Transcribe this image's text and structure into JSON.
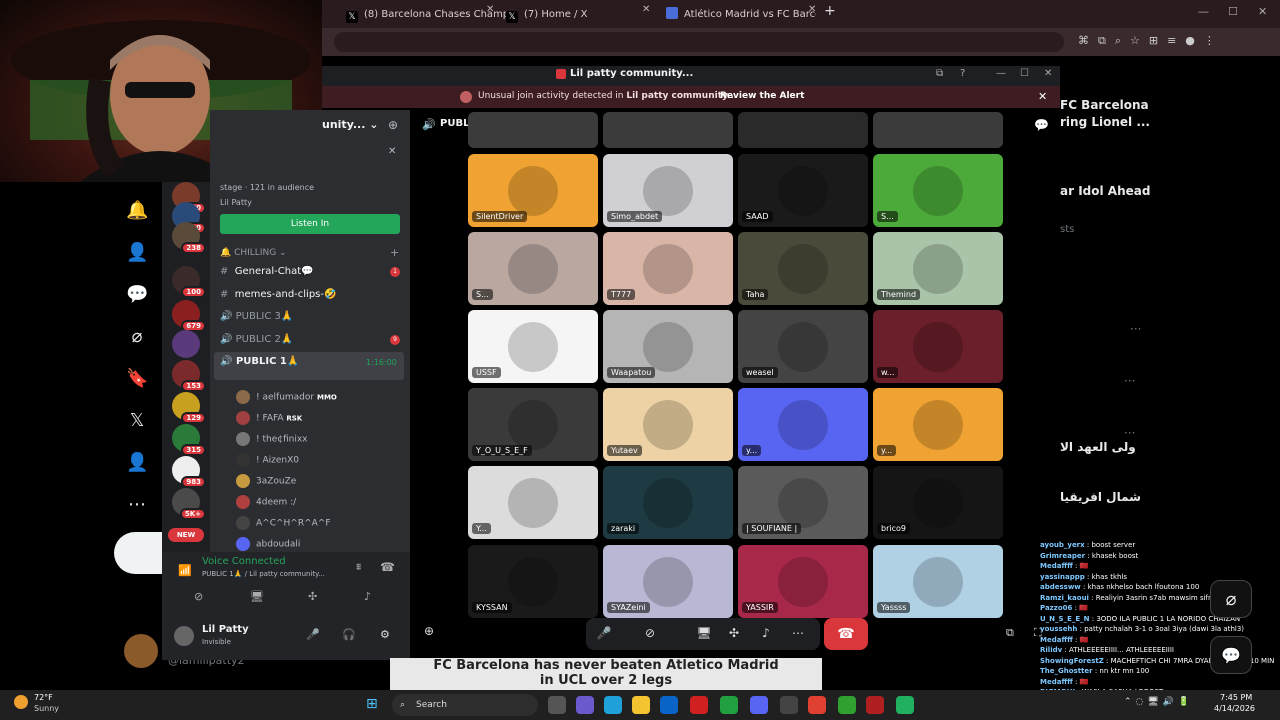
{
  "browser": {
    "tabs": [
      {
        "label": "(8) Barcelona Chases Champion",
        "icon_color": "#000000"
      },
      {
        "label": "(7) Home / X",
        "icon_color": "#000000"
      },
      {
        "label": "Atlético Madrid vs FC Barcelona",
        "icon_color": "#4a6cd6"
      }
    ],
    "new_tab": "+"
  },
  "x_right": {
    "item1": "FC Barcelona",
    "item1b": "ring Lionel ...",
    "item2": "ar Idol Ahead",
    "item2b": "sts",
    "arabic1": "ولى العهد الا",
    "arabic2": "شمال افريقيا"
  },
  "discord": {
    "window_title": "Lil patty community...",
    "alert": {
      "prefix": "Unusual join activity detected in",
      "server": "Lil patty community...",
      "action": "Review the Alert"
    },
    "server_name": "unity...",
    "stage": {
      "meta": "stage · 121 in audience",
      "host": "Lil Patty",
      "listen_label": "Listen In"
    },
    "category": "CHILLING",
    "channels": [
      {
        "name": "General-Chat💬",
        "type": "text",
        "badge": "1"
      },
      {
        "name": "memes-and-clips-🤣",
        "type": "text",
        "badge": ""
      },
      {
        "name": "PUBLIC 3🙏",
        "type": "voice",
        "badge": ""
      },
      {
        "name": "PUBLIC 2🙏",
        "type": "voice",
        "badge": "9"
      },
      {
        "name": "PUBLIC 1🙏",
        "type": "voice",
        "badge": "",
        "time": "1:16:00"
      }
    ],
    "voice_users": [
      {
        "name": "! aelfumador",
        "tag": "MMO",
        "color": "#8a6a4a"
      },
      {
        "name": "! FAFA",
        "tag": "RSK",
        "color": "#a04040"
      },
      {
        "name": "! the¢finixx",
        "tag": "",
        "color": "#777777"
      },
      {
        "name": "! AizenX0",
        "tag": "",
        "color": "#333333"
      },
      {
        "name": "3aZouZe",
        "tag": "",
        "color": "#c89a40"
      },
      {
        "name": "4deem :/",
        "tag": "",
        "color": "#b04040"
      },
      {
        "name": "A^C^H^R^A^F",
        "tag": "",
        "color": "#444444"
      },
      {
        "name": "abdoudali",
        "tag": "",
        "color": "#5865f2"
      }
    ],
    "server_badges": [
      "450",
      "280",
      "238",
      "100",
      "679",
      "153",
      "129",
      "315",
      "983",
      "5K+"
    ],
    "new_label": "NEW",
    "voice_connected": "Voice Connected",
    "voice_channel": "PUBLIC 1🙏 / Lil patty community...",
    "user": {
      "name": "Lil Patty",
      "status": "Invisible"
    },
    "stage_header": "PUBLIC 1🙏",
    "tiles": [
      {
        "name": "SilentDriver",
        "bg": "#f0a332"
      },
      {
        "name": "Simo_abdet",
        "bg": "#cfcfd4"
      },
      {
        "name": "SAAD",
        "bg": "#1a1a1a"
      },
      {
        "name": "S...",
        "bg": "#4caa3a"
      },
      {
        "name": "S...",
        "bg": "#b9a7a0"
      },
      {
        "name": "T777",
        "bg": "#d9b5a8"
      },
      {
        "name": "Taha",
        "bg": "#4a4a3a"
      },
      {
        "name": "Themind",
        "bg": "#a9c4a8"
      },
      {
        "name": "USSF",
        "bg": "#f5f5f5"
      },
      {
        "name": "Waapatou",
        "bg": "#b5b5b5"
      },
      {
        "name": "weasel",
        "bg": "#444444"
      },
      {
        "name": "w...",
        "bg": "#6a1f2a"
      },
      {
        "name": "Y_O_U_S_E_F",
        "bg": "#3a3a3a"
      },
      {
        "name": "Yutaev",
        "bg": "#ecd2a4"
      },
      {
        "name": "y...",
        "bg": "#5865f2"
      },
      {
        "name": "y...",
        "bg": "#f0a332"
      },
      {
        "name": "Y...",
        "bg": "#dcdcdc"
      },
      {
        "name": "zaraki",
        "bg": "#1e3a42"
      },
      {
        "name": "| SOUFIANE |",
        "bg": "#5a5a5a"
      },
      {
        "name": "brico9",
        "bg": "#151515"
      },
      {
        "name": "KYSSAN",
        "bg": "#1a1a1a"
      },
      {
        "name": "SYAZeini",
        "bg": "#b8b8d4"
      },
      {
        "name": "YASSIR",
        "bg": "#a8284a"
      },
      {
        "name": "Yassss",
        "bg": "#b0d0e4"
      }
    ]
  },
  "banner": {
    "line1": "FC Barcelona has never beaten Atletico Madrid",
    "line2": "in UCL over 2 legs"
  },
  "chat": [
    {
      "user": "ayoub_yerx",
      "msg": "boost server"
    },
    {
      "user": "Grimreaper",
      "msg": "khasek boost"
    },
    {
      "user": "Medaffff",
      "msg": "🇲🇦"
    },
    {
      "user": "yassinappp",
      "msg": "khas tkhls"
    },
    {
      "user": "abdessww",
      "msg": "khas nkhelso bach lfoutona 100"
    },
    {
      "user": "Ramzi_kaoui",
      "msg": "Realiyin 3asrin s7ab mawsim sifri 🤔"
    },
    {
      "user": "Pazzo06",
      "msg": "🇲🇦"
    },
    {
      "user": "U_N_S_E_E_N",
      "msg": "3ODO ILA PUBLIC 1 LA NORIDO CHAIZAN"
    },
    {
      "user": "youssehh",
      "msg": "patty nchalah 3-1 o 3oal 3iya (dawi 3la athl3)"
    },
    {
      "user": "Medaffff",
      "msg": "🇲🇦"
    },
    {
      "user": "Rilidv",
      "msg": "ATHLEEEEEIIII... ATHLEEEEEIIII"
    },
    {
      "user": "ShowingForestZ",
      "msg": "MACHEFTICH CHI 7MRA DYAL MARTIN F 10 MIN"
    },
    {
      "user": "The_Ghostter",
      "msg": "nn ktr mn 100"
    },
    {
      "user": "Medaffff",
      "msg": "🇲🇦"
    },
    {
      "user": "BIGMOHI",
      "msg": "WA9LA SASHA LBOOST"
    }
  ],
  "taskbar": {
    "weather_temp": "72°F",
    "weather_desc": "Sunny",
    "search": "Search",
    "time": "7:45 PM",
    "date": "4/14/2026"
  }
}
